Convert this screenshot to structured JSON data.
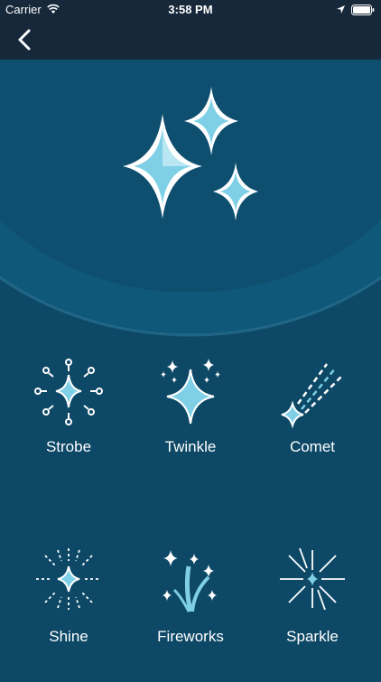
{
  "status": {
    "carrier": "Carrier",
    "time": "3:58 PM"
  },
  "nav": {
    "back_icon": "chevron-left-icon"
  },
  "hero": {
    "icon": "sparkles-icon"
  },
  "colors": {
    "background": "#0d4866",
    "bar": "#16283a",
    "accent": "#6cc4dd"
  },
  "effects": [
    {
      "label": "Strobe",
      "icon": "strobe-icon"
    },
    {
      "label": "Twinkle",
      "icon": "twinkle-icon"
    },
    {
      "label": "Comet",
      "icon": "comet-icon"
    },
    {
      "label": "Shine",
      "icon": "shine-icon"
    },
    {
      "label": "Fireworks",
      "icon": "fireworks-icon"
    },
    {
      "label": "Sparkle",
      "icon": "sparkle-icon"
    }
  ]
}
